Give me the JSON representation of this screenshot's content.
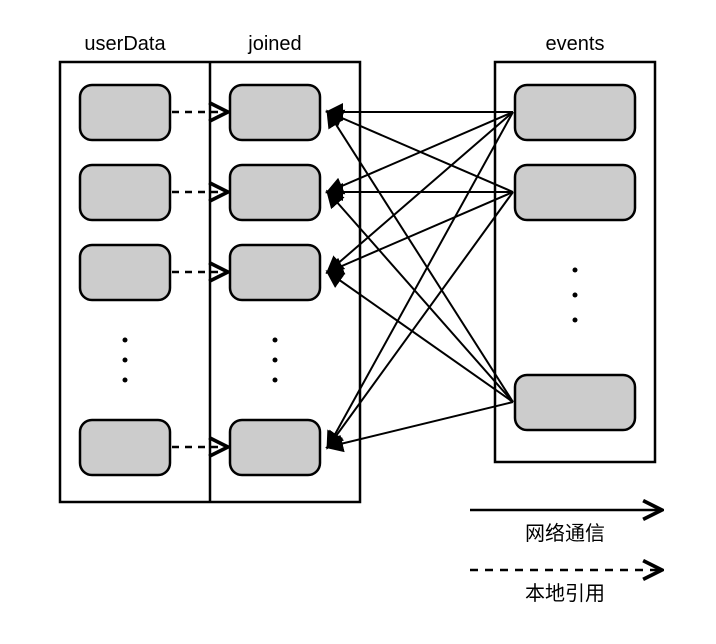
{
  "columns": {
    "left_label": "userData",
    "middle_label": "joined",
    "right_label": "events"
  },
  "legend": {
    "network_label": "网络通信",
    "local_label": "本地引用"
  },
  "chart_data": {
    "type": "diagram",
    "description": "RDD partitioning diagram with three columns. Left column (userData) is co-partitioned with middle column (joined) via local references (dashed arrows). Right column (events) connects to middle column via network communication (solid arrows, all-to-all shuffle).",
    "columns": [
      {
        "name": "userData",
        "partitions": 4,
        "has_ellipsis": true
      },
      {
        "name": "joined",
        "partitions": 4,
        "has_ellipsis": true
      },
      {
        "name": "events",
        "partitions": 3,
        "has_ellipsis": true
      }
    ],
    "edges": [
      {
        "from": "userData",
        "to": "joined",
        "style": "dashed",
        "mapping": "one-to-one",
        "meaning": "local reference"
      },
      {
        "from": "events",
        "to": "joined",
        "style": "solid",
        "mapping": "all-to-all",
        "meaning": "network communication"
      }
    ],
    "legend": [
      {
        "style": "solid-arrow",
        "label": "网络通信"
      },
      {
        "style": "dashed-arrow",
        "label": "本地引用"
      }
    ]
  }
}
